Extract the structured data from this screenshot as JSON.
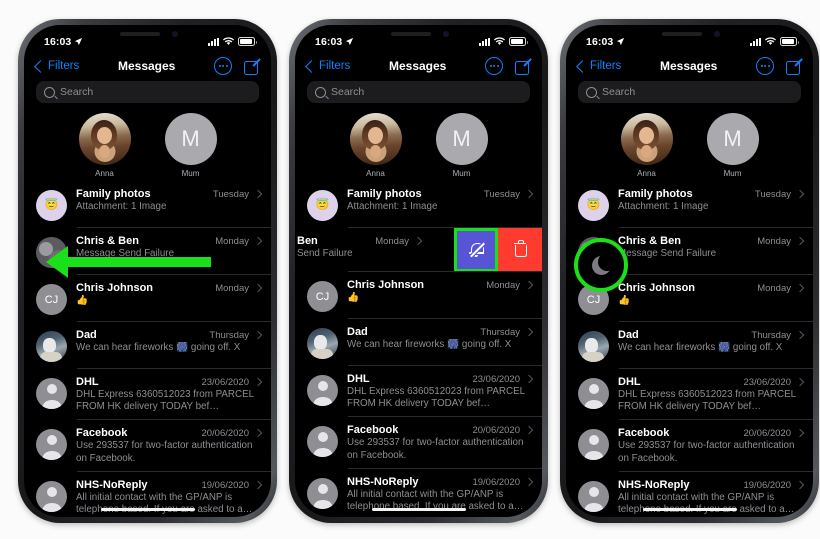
{
  "page": {
    "background_color": "#fbfbfb",
    "accent_highlight_color": "#19e019",
    "tint_blue": "#0a84ff",
    "mute_button_color": "#5754d6",
    "delete_button_color": "#ff3b30"
  },
  "status_bar": {
    "time": "16:03",
    "location_icon": "location-arrow-icon",
    "cellular_icon": "cellular-bars-icon",
    "wifi_icon": "wifi-icon",
    "battery_icon": "battery-icon"
  },
  "nav": {
    "back_label": "Filters",
    "title": "Messages",
    "more_icon": "ellipsis-circle-icon",
    "compose_icon": "compose-icon"
  },
  "search": {
    "placeholder": "Search",
    "icon": "search-icon"
  },
  "pinned": [
    {
      "name": "Anna",
      "avatar_type": "photo"
    },
    {
      "name": "Mum",
      "avatar_type": "letter",
      "initial": "M"
    }
  ],
  "conversations": [
    {
      "name": "Family photos",
      "time": "Tuesday",
      "preview": "Attachment: 1 Image",
      "avatar_type": "emoji",
      "emoji": "😇"
    },
    {
      "name": "Chris & Ben",
      "time": "Monday",
      "preview": "Message Send Failure",
      "avatar_type": "group"
    },
    {
      "name": "Chris Johnson",
      "time": "Monday",
      "preview": "👍",
      "avatar_type": "initials",
      "initials": "CJ"
    },
    {
      "name": "Dad",
      "time": "Thursday",
      "preview": "We can hear fireworks 🎆 going off. X",
      "avatar_type": "dad"
    },
    {
      "name": "DHL",
      "time": "23/06/2020",
      "preview": "DHL Express 6360512023 from PARCEL FROM HK delivery TODAY bef…",
      "avatar_type": "generic"
    },
    {
      "name": "Facebook",
      "time": "20/06/2020",
      "preview": "Use 293537 for two-factor authentication on Facebook.",
      "avatar_type": "generic"
    },
    {
      "name": "NHS-NoReply",
      "time": "19/06/2020",
      "preview": "All initial contact with the GP/ANP is telephone based. If you are asked to a…",
      "avatar_type": "generic"
    }
  ],
  "swipe": {
    "row_name": "Ben",
    "row_time": "Monday",
    "row_preview": "Send Failure",
    "mute_icon": "bell-slash-icon",
    "delete_icon": "trash-icon"
  },
  "phone3": {
    "moon_icon": "crescent-moon-icon",
    "highlighted_row_name": "Chris & Ben",
    "highlighted_row_preview": "Message Send Failure"
  },
  "annotation": {
    "arrow_icon": "green-arrow-left-icon",
    "circle_icon": "green-circle-highlight-icon"
  }
}
